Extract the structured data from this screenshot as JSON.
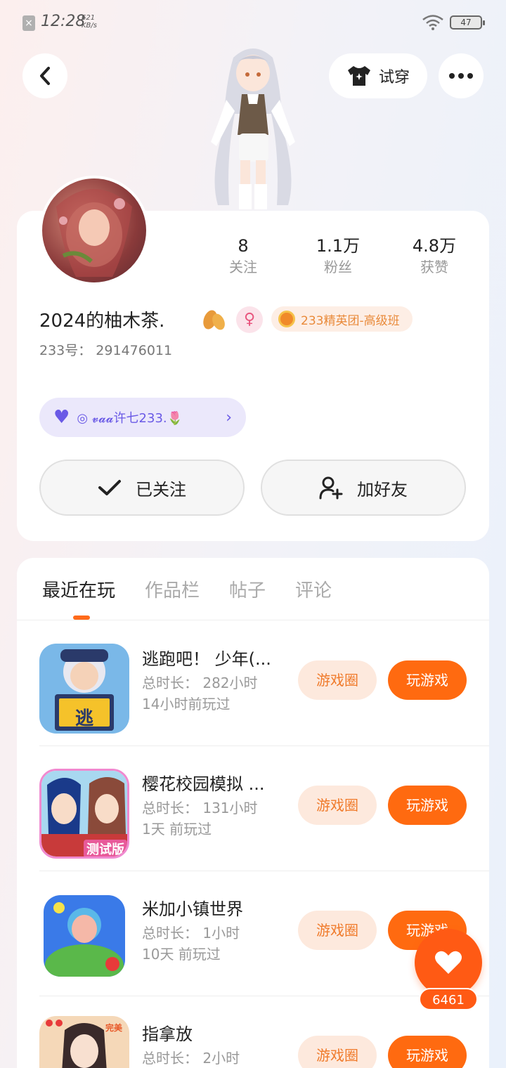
{
  "status_bar": {
    "time": "12:28",
    "speed_value": "621",
    "speed_unit": "KB/s",
    "battery": "47"
  },
  "nav": {
    "try_on_label": "试穿"
  },
  "profile": {
    "stats": [
      {
        "value": "8",
        "label": "关注"
      },
      {
        "value": "1.1万",
        "label": "粉丝"
      },
      {
        "value": "4.8万",
        "label": "获赞"
      }
    ],
    "username": "2024的柚木茶.",
    "gender_symbol": "♀",
    "rank_label": "233精英团-高级班",
    "user_id": "233号： 291476011",
    "signature": "◎ 𝓿𝓪𝓪许七233.🌷",
    "follow_label": "已关注",
    "add_friend_label": "加好友"
  },
  "tabs": [
    {
      "label": "最近在玩",
      "active": true
    },
    {
      "label": "作品栏",
      "active": false
    },
    {
      "label": "帖子",
      "active": false
    },
    {
      "label": "评论",
      "active": false
    }
  ],
  "games": [
    {
      "title": "逃跑吧！ 少年(...",
      "total_time": "总时长： 282小时",
      "last_played": "14小时前玩过",
      "circle_label": "游戏圈",
      "play_label": "玩游戏",
      "icon_text": "逃"
    },
    {
      "title": "樱花校园模拟 ...",
      "total_time": "总时长： 131小时",
      "last_played": "1天 前玩过",
      "circle_label": "游戏圈",
      "play_label": "玩游戏",
      "icon_text": "测试版"
    },
    {
      "title": "米加小镇世界",
      "total_time": "总时长： 1小时",
      "last_played": "10天 前玩过",
      "circle_label": "游戏圈",
      "play_label": "玩游戏",
      "icon_text": ""
    },
    {
      "title": "指拿放",
      "total_time": "总时长： 2小时",
      "last_played": "",
      "circle_label": "游戏圈",
      "play_label": "玩游戏",
      "icon_text": "完美"
    }
  ],
  "like": {
    "count": "6461"
  },
  "colors": {
    "accent": "#ff6a10",
    "accent_light": "#fde9dd",
    "signature": "#6a5ae6"
  }
}
